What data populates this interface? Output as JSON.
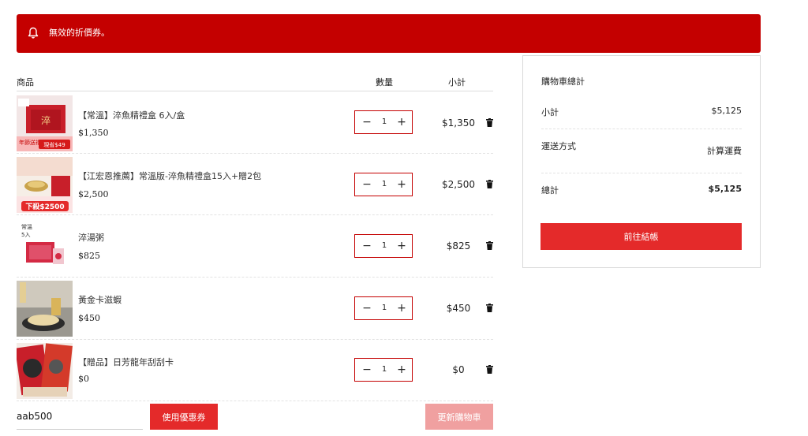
{
  "notice": {
    "message": "無效的折價券。",
    "icon": "bell-icon"
  },
  "cart": {
    "headers": {
      "product": "商品",
      "quantity": "數量",
      "subtotal": "小計"
    },
    "items": [
      {
        "name": "【常溫】淬魚精禮盒 6入/盒",
        "price": "$1,350",
        "qty": "1",
        "subtotal": "$1,350",
        "thumb": {
          "badge_text": "年節送禮",
          "promo_text": "現省$49",
          "brand": "淬"
        }
      },
      {
        "name": "【江宏恩推薦】常溫版-淬魚精禮盒15入+贈2包",
        "price": "$2,500",
        "qty": "1",
        "subtotal": "$2,500",
        "thumb": {
          "promo_text": "下殺$2500"
        }
      },
      {
        "name": "淬湯粥",
        "price": "$825",
        "qty": "1",
        "subtotal": "$825",
        "thumb": {
          "label_top": "常溫",
          "label_count": "5入"
        }
      },
      {
        "name": "黃金卡滋蝦",
        "price": "$450",
        "qty": "1",
        "subtotal": "$450",
        "thumb": {}
      },
      {
        "name": "【贈品】日芳龍年刮刮卡",
        "price": "$0",
        "qty": "1",
        "subtotal": "$0",
        "thumb": {}
      }
    ],
    "qty_minus": "−",
    "qty_plus": "+",
    "coupon": {
      "value": "aab500",
      "apply_label": "使用優惠券"
    },
    "update_label": "更新購物車"
  },
  "totals": {
    "title": "購物車總計",
    "subtotal_label": "小計",
    "subtotal_value": "$5,125",
    "shipping_label": "運送方式",
    "shipping_value": "計算運費",
    "total_label": "總計",
    "total_value": "$5,125",
    "checkout_label": "前往結帳"
  },
  "colors": {
    "brand_red": "#c40000",
    "button_red": "#e42a2a",
    "disabled_red": "#f0a0a0"
  }
}
